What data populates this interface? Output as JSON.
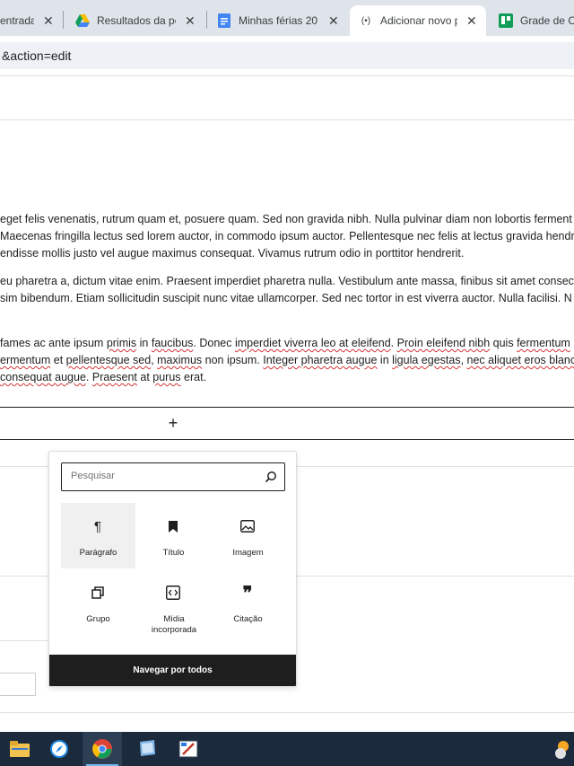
{
  "browser": {
    "tabs": [
      {
        "title": "entrada",
        "favicon": "gmail-icon",
        "active": false
      },
      {
        "title": "Resultados da pe",
        "favicon": "google-drive-icon",
        "active": false
      },
      {
        "title": "Minhas férias 20",
        "favicon": "google-docs-icon",
        "active": false
      },
      {
        "title": "Adicionar novo p",
        "favicon": "broadcast-icon",
        "active": true
      },
      {
        "title": "Grade de Co",
        "favicon": "trello-icon",
        "active": false
      }
    ],
    "url": "&action=edit"
  },
  "editor": {
    "paragraphs": [
      [
        "eget felis venenatis, rutrum quam et, posuere quam. Sed non gravida nibh. Nulla pulvinar diam non lobortis ferment",
        " Maecenas fringilla lectus sed lorem auctor, in commodo ipsum auctor. Pellentesque nec felis at lectus gravida hendr",
        "endisse mollis justo vel augue maximus consequat. Vivamus rutrum odio in porttitor hendrerit."
      ],
      [
        "eu pharetra a, dictum vitae enim. Praesent imperdiet pharetra nulla. Vestibulum ante massa, finibus sit amet consec",
        "sim bibendum. Etiam sollicitudin suscipit nunc vitae ullamcorper. Sed nec tortor in est viverra auctor. Nulla facilisi. N"
      ],
      {
        "line1": [
          " fames ac ante ipsum ",
          "primis",
          " in ",
          "faucibus",
          ". Donec ",
          "imperdiet viverra leo at eleifend",
          ". ",
          "Proin eleifend nibh",
          " quis ",
          "fermentum"
        ],
        "line2": [
          "ermentum",
          " et ",
          "pellentesque sed",
          ", ",
          "maximus",
          " non ipsum. ",
          "Integer pharetra augue",
          " in ",
          "ligula egestas",
          ", ",
          "nec aliquet eros blanc"
        ],
        "line3": [
          "consequat augue",
          ". ",
          "Praesent",
          " at ",
          "purus",
          " erat."
        ]
      }
    ],
    "appender_symbol": "+"
  },
  "inserter": {
    "search_placeholder": "Pesquisar",
    "blocks": [
      {
        "label": "Parágrafo",
        "icon": "paragraph-icon",
        "selected": true
      },
      {
        "label": "Título",
        "icon": "bookmark-icon",
        "selected": false
      },
      {
        "label": "Imagem",
        "icon": "image-icon",
        "selected": false
      },
      {
        "label": "Grupo",
        "icon": "group-icon",
        "selected": false
      },
      {
        "label": "Mídia incorporada",
        "icon": "embed-icon",
        "selected": false
      },
      {
        "label": "Citação",
        "icon": "quote-icon",
        "selected": false
      }
    ],
    "browse_all": "Navegar por todos"
  },
  "taskbar": {
    "items": [
      "file-explorer-icon",
      "safari-icon",
      "chrome-icon",
      "notes-icon",
      "paint-icon",
      "update-icon"
    ]
  },
  "colors": {
    "accent": "#1e1e1e",
    "spell_error": "#d63638",
    "taskbar": "#1b2a3c"
  }
}
